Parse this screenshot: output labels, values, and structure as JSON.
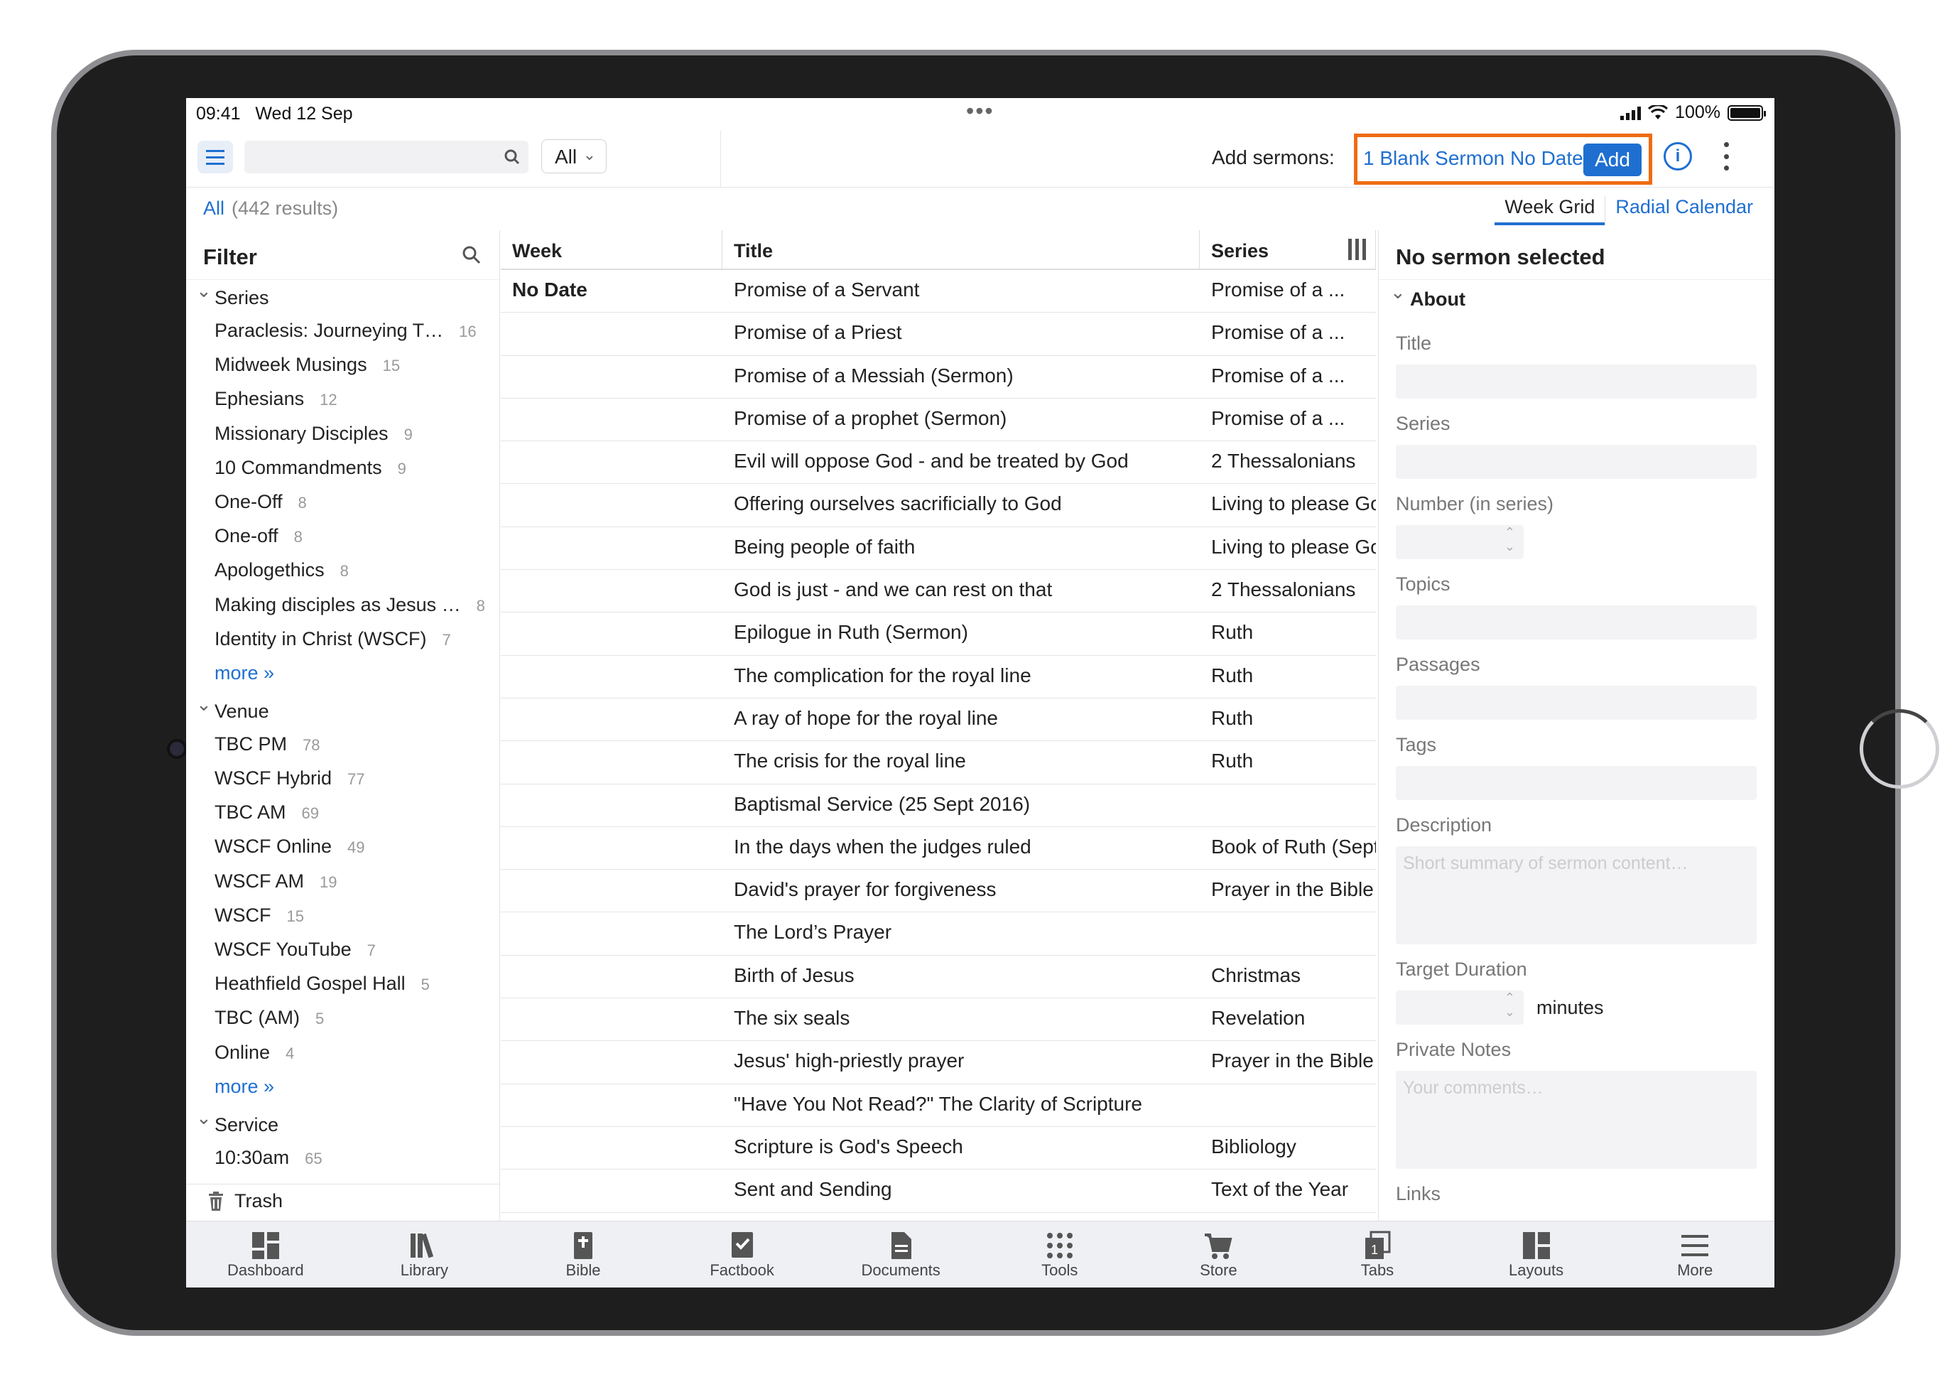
{
  "status": {
    "time": "09:41",
    "date": "Wed 12 Sep",
    "battery": "100%"
  },
  "toolbar": {
    "filter_option": "All",
    "add_label": "Add sermons:",
    "add_selection": "1 Blank Sermon No Date",
    "add_button": "Add",
    "highlight_color": "#ef6c11",
    "accent_color": "#1f6fd1"
  },
  "subbar": {
    "scope": "All",
    "result_count": "(442 results)",
    "tab_week_grid": "Week Grid",
    "tab_radial": "Radial Calendar"
  },
  "filter": {
    "title": "Filter",
    "groups": [
      {
        "title": "Series",
        "items": [
          {
            "label": "Paraclesis: Journeying T…",
            "count": "16"
          },
          {
            "label": "Midweek Musings",
            "count": "15"
          },
          {
            "label": "Ephesians",
            "count": "12"
          },
          {
            "label": "Missionary Disciples",
            "count": "9"
          },
          {
            "label": "10 Commandments",
            "count": "9"
          },
          {
            "label": "One-Off",
            "count": "8"
          },
          {
            "label": "One-off",
            "count": "8"
          },
          {
            "label": "Apologethics",
            "count": "8"
          },
          {
            "label": "Making disciples as Jesus …",
            "count": "8"
          },
          {
            "label": "Identity in Christ (WSCF)",
            "count": "7"
          }
        ],
        "more": "more »"
      },
      {
        "title": "Venue",
        "items": [
          {
            "label": "TBC PM",
            "count": "78"
          },
          {
            "label": "WSCF Hybrid",
            "count": "77"
          },
          {
            "label": "TBC AM",
            "count": "69"
          },
          {
            "label": "WSCF Online",
            "count": "49"
          },
          {
            "label": "WSCF AM",
            "count": "19"
          },
          {
            "label": "WSCF",
            "count": "15"
          },
          {
            "label": "WSCF YouTube",
            "count": "7"
          },
          {
            "label": "Heathfield Gospel Hall",
            "count": "5"
          },
          {
            "label": "TBC (AM)",
            "count": "5"
          },
          {
            "label": "Online",
            "count": "4"
          }
        ],
        "more": "more »"
      },
      {
        "title": "Service",
        "items": [
          {
            "label": "10:30am",
            "count": "65"
          }
        ]
      }
    ],
    "trash": "Trash"
  },
  "grid": {
    "headers": {
      "week": "Week",
      "title": "Title",
      "series": "Series"
    },
    "rows": [
      {
        "week": "No Date",
        "title": "Promise of a Servant",
        "series": "Promise of a ..."
      },
      {
        "week": "",
        "title": "Promise of a Priest",
        "series": "Promise of a ..."
      },
      {
        "week": "",
        "title": "Promise of a Messiah (Sermon)",
        "series": "Promise of a ..."
      },
      {
        "week": "",
        "title": "Promise of a prophet (Sermon)",
        "series": "Promise of a ..."
      },
      {
        "week": "",
        "title": "Evil will oppose God - and be treated by God",
        "series": "2 Thessalonians"
      },
      {
        "week": "",
        "title": "Offering ourselves sacrificially to God",
        "series": "Living to please Go"
      },
      {
        "week": "",
        "title": "Being people of faith",
        "series": "Living to please Go"
      },
      {
        "week": "",
        "title": "God is just - and we can rest on that",
        "series": "2 Thessalonians"
      },
      {
        "week": "",
        "title": "Epilogue in Ruth (Sermon)",
        "series": "Ruth"
      },
      {
        "week": "",
        "title": "The complication for the royal line",
        "series": "Ruth"
      },
      {
        "week": "",
        "title": "A ray of hope for the royal line",
        "series": "Ruth"
      },
      {
        "week": "",
        "title": "The crisis for the royal line",
        "series": "Ruth"
      },
      {
        "week": "",
        "title": "Baptismal Service (25 Sept 2016)",
        "series": ""
      },
      {
        "week": "",
        "title": "In the days when the judges ruled",
        "series": "Book of Ruth (Sept"
      },
      {
        "week": "",
        "title": "David's prayer for forgiveness",
        "series": "Prayer in the Bible"
      },
      {
        "week": "",
        "title": "The Lord’s Prayer",
        "series": ""
      },
      {
        "week": "",
        "title": "Birth of Jesus",
        "series": "Christmas"
      },
      {
        "week": "",
        "title": "The six seals",
        "series": "Revelation"
      },
      {
        "week": "",
        "title": "Jesus' high-priestly prayer",
        "series": "Prayer in the Bible"
      },
      {
        "week": "",
        "title": "\"Have You Not Read?\" The Clarity of Scripture",
        "series": ""
      },
      {
        "week": "",
        "title": "Scripture is God's Speech",
        "series": "Bibliology"
      },
      {
        "week": "",
        "title": "Sent and Sending",
        "series": "Text of the Year"
      }
    ]
  },
  "detail": {
    "title": "No sermon selected",
    "section": "About",
    "labels": {
      "title": "Title",
      "series": "Series",
      "number": "Number (in series)",
      "topics": "Topics",
      "passages": "Passages",
      "tags": "Tags",
      "description": "Description",
      "target_duration": "Target Duration",
      "private_notes": "Private Notes",
      "links": "Links"
    },
    "placeholders": {
      "description": "Short summary of sermon content…",
      "notes": "Your comments…"
    },
    "minutes": "minutes"
  },
  "tabbar": [
    {
      "label": "Dashboard",
      "icon": "dashboard-icon"
    },
    {
      "label": "Library",
      "icon": "library-icon"
    },
    {
      "label": "Bible",
      "icon": "bible-icon"
    },
    {
      "label": "Factbook",
      "icon": "factbook-icon"
    },
    {
      "label": "Documents",
      "icon": "documents-icon"
    },
    {
      "label": "Tools",
      "icon": "tools-icon"
    },
    {
      "label": "Store",
      "icon": "store-icon"
    },
    {
      "label": "Tabs",
      "icon": "tabs-icon"
    },
    {
      "label": "Layouts",
      "icon": "layouts-icon"
    },
    {
      "label": "More",
      "icon": "more-icon"
    }
  ]
}
